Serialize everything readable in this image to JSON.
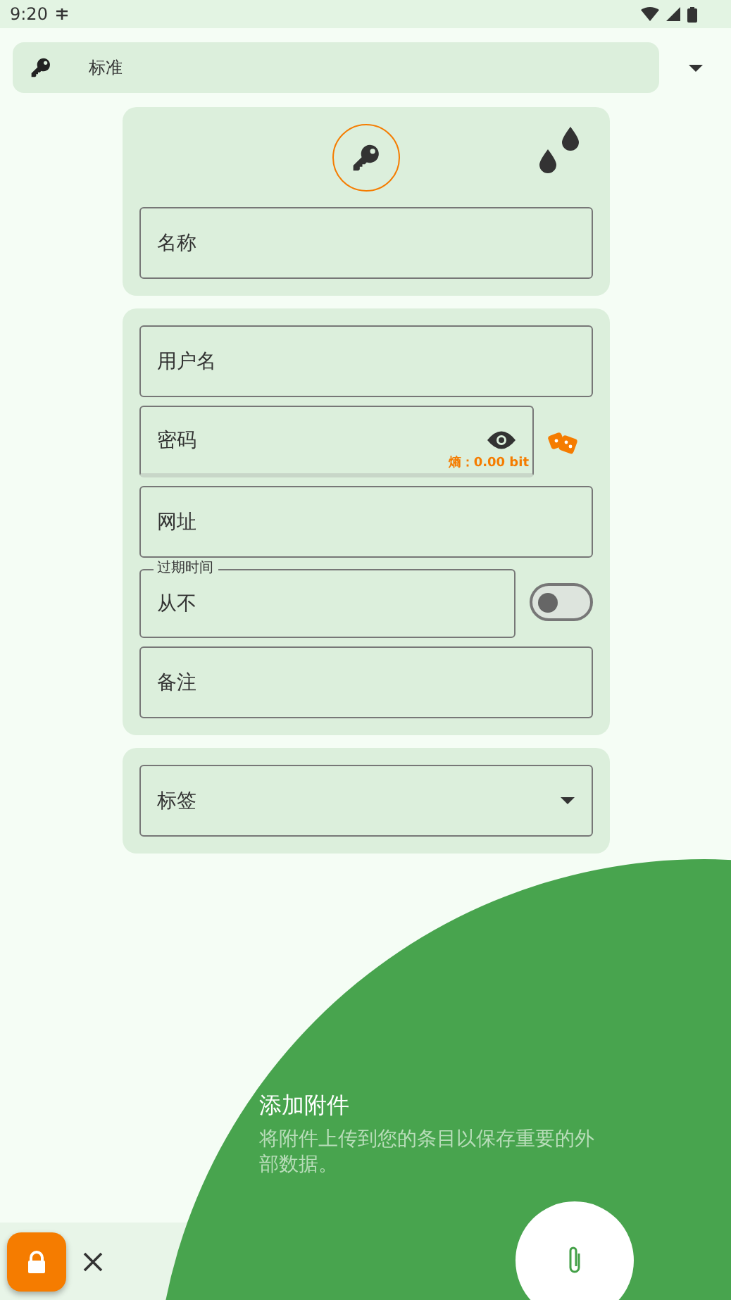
{
  "status_bar": {
    "time": "9:20"
  },
  "template": {
    "label": "标准"
  },
  "header": {
    "icon_selected": false
  },
  "name_field": {
    "placeholder": "名称"
  },
  "fields": [
    {
      "kind": "text",
      "placeholder": "用户名"
    },
    {
      "kind": "password",
      "placeholder": "密码",
      "entropy": "熵：0.00 bit"
    },
    {
      "kind": "text",
      "placeholder": "网址"
    },
    {
      "kind": "expiry",
      "label": "过期时间",
      "value": "从不",
      "on": false
    },
    {
      "kind": "text",
      "placeholder": "备注"
    }
  ],
  "tags": {
    "placeholder": "标签"
  },
  "tutorial": {
    "title": "添加附件",
    "body": "将附件上传到您的条目以保存重要的外部数据。"
  }
}
